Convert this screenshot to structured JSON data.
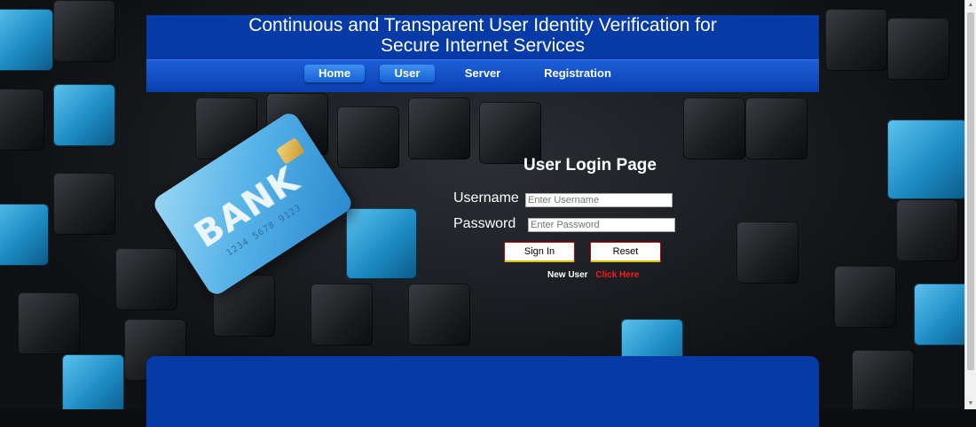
{
  "header": {
    "title_line1": "Continuous and Transparent User Identity Verification for",
    "title_line2": "Secure Internet Services"
  },
  "nav": {
    "items": [
      {
        "label": "Home"
      },
      {
        "label": "User"
      },
      {
        "label": "Server"
      },
      {
        "label": "Registration"
      }
    ]
  },
  "card": {
    "brand": "BANK",
    "number": "1234 5678 9123"
  },
  "login": {
    "title": "User Login Page",
    "username_label": "Username",
    "username_placeholder": "Enter Username",
    "password_label": "Password",
    "password_placeholder": "Enter Password",
    "signin_label": "Sign In",
    "reset_label": "Reset",
    "new_user_text": "New User",
    "click_here_text": "Click Here"
  },
  "colors": {
    "header_blue": "#063aa6",
    "nav_pill_blue": "#3d8ff0",
    "click_here_red": "#ff1a1a"
  },
  "scrollbar": {
    "up_icon": "triangle-up-icon",
    "down_icon": "triangle-down-icon"
  }
}
